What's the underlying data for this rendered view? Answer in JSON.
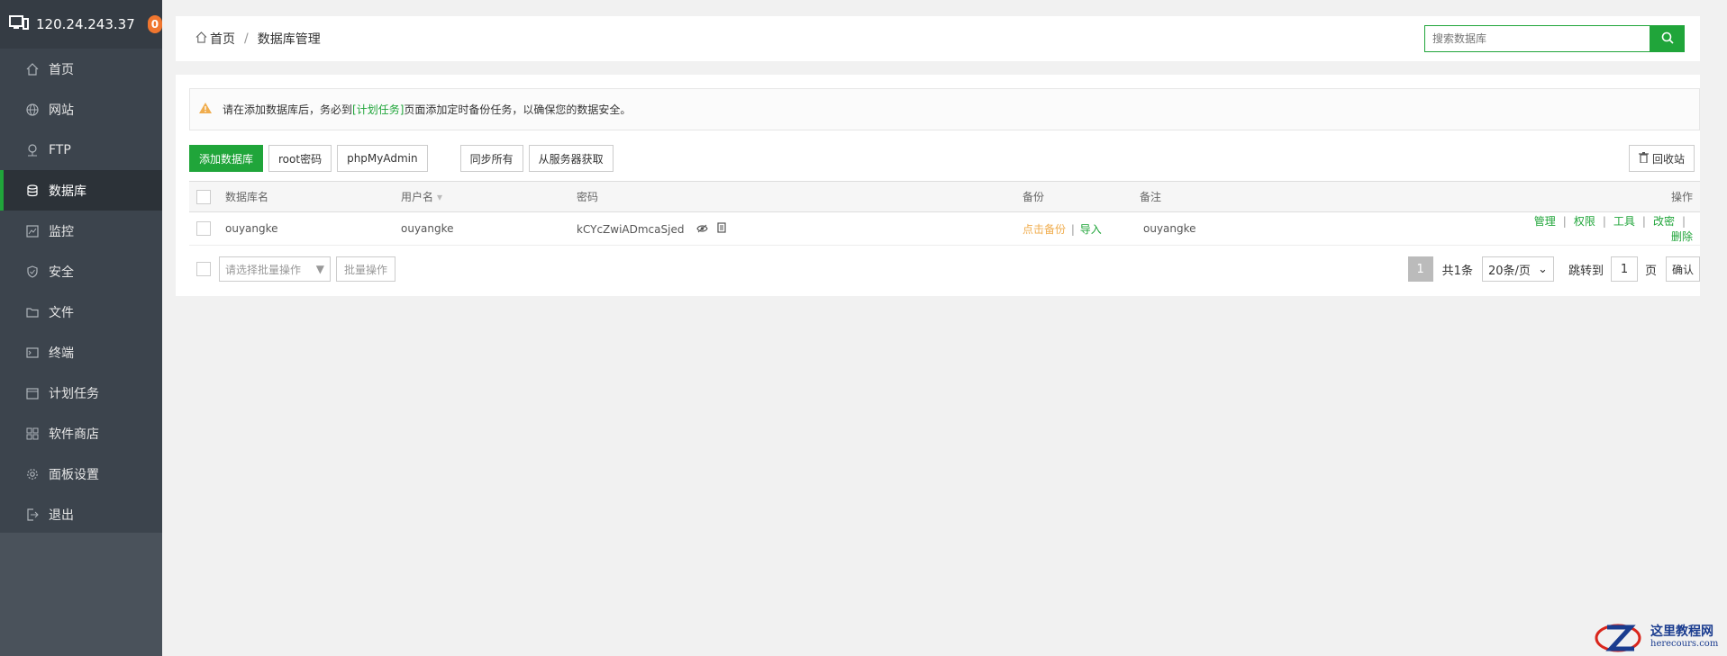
{
  "sidebar": {
    "server_ip": "120.24.243.37",
    "badge": "0",
    "items": [
      {
        "label": "首页",
        "icon": "home-icon"
      },
      {
        "label": "网站",
        "icon": "globe-icon"
      },
      {
        "label": "FTP",
        "icon": "ftp-icon"
      },
      {
        "label": "数据库",
        "icon": "database-icon",
        "active": true
      },
      {
        "label": "监控",
        "icon": "monitor-icon"
      },
      {
        "label": "安全",
        "icon": "shield-icon"
      },
      {
        "label": "文件",
        "icon": "folder-icon"
      },
      {
        "label": "终端",
        "icon": "terminal-icon"
      },
      {
        "label": "计划任务",
        "icon": "calendar-icon"
      },
      {
        "label": "软件商店",
        "icon": "apps-icon"
      },
      {
        "label": "面板设置",
        "icon": "gear-icon"
      },
      {
        "label": "退出",
        "icon": "logout-icon"
      }
    ]
  },
  "breadcrumb": {
    "home": "首页",
    "separator": "/",
    "current": "数据库管理"
  },
  "search": {
    "placeholder": "搜索数据库"
  },
  "notice": {
    "prefix": "请在添加数据库后，务必到",
    "link": "[计划任务]",
    "suffix": "页面添加定时备份任务，以确保您的数据安全。"
  },
  "toolbar": {
    "add": "添加数据库",
    "root_password": "root密码",
    "phpmyadmin": "phpMyAdmin",
    "sync_all": "同步所有",
    "fetch_server": "从服务器获取",
    "recycle": "回收站"
  },
  "table": {
    "headers": {
      "name": "数据库名",
      "user": "用户名",
      "password": "密码",
      "backup": "备份",
      "remark": "备注",
      "actions": "操作"
    },
    "rows": [
      {
        "name": "ouyangke",
        "user": "ouyangke",
        "password": "kCYcZwiADmcaSjed",
        "backup": "点击备份",
        "backup_sep": "|",
        "import": "导入",
        "remark": "ouyangke",
        "ops": [
          "管理",
          "权限",
          "工具",
          "改密",
          "删除"
        ]
      }
    ]
  },
  "footer": {
    "batch_placeholder": "请选择批量操作",
    "batch_button": "批量操作",
    "current_page": "1",
    "total": "共1条",
    "per_page": "20条/页",
    "jump_to": "跳转到",
    "jump_value": "1",
    "page_unit": "页",
    "confirm": "确认"
  },
  "watermark": {
    "zh": "这里教程网",
    "en": "herecours.com"
  },
  "colors": {
    "accent": "#20a53a",
    "sidebar": "#3c444d",
    "badge": "#f0762f",
    "warn": "#f0ad4e"
  }
}
